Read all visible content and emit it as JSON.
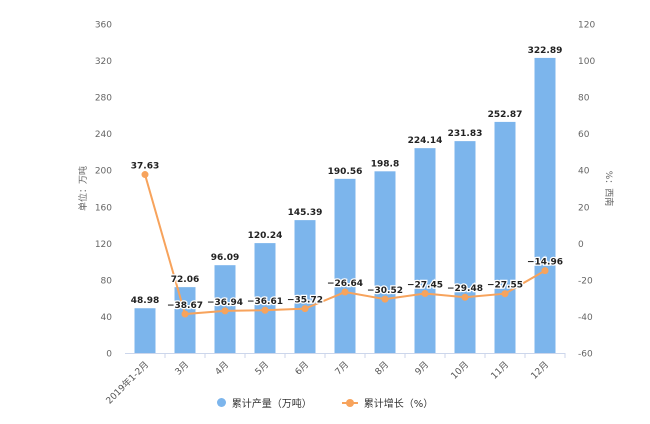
{
  "chart_data": {
    "type": "bar",
    "categories": [
      "2019年1-2月",
      "3月",
      "4月",
      "5月",
      "6月",
      "7月",
      "8月",
      "9月",
      "10月",
      "11月",
      "12月"
    ],
    "series": [
      {
        "name": "累计产量（万吨）",
        "type": "bar",
        "axis": "left",
        "color": "#7cb5ec",
        "values": [
          48.98,
          72.06,
          96.09,
          120.24,
          145.39,
          190.56,
          198.8,
          224.14,
          231.83,
          252.87,
          322.89
        ],
        "labels": [
          "48.98",
          "72.06",
          "96.09",
          "120.24",
          "145.39",
          "190.56",
          "198.8",
          "224.14",
          "231.83",
          "252.87",
          "322.89"
        ]
      },
      {
        "name": "累计增长（%）",
        "type": "line",
        "axis": "right",
        "color": "#f7a35c",
        "values": [
          37.63,
          -38.67,
          -36.94,
          -36.61,
          -35.72,
          -26.64,
          -30.52,
          -27.45,
          -29.48,
          -27.55,
          -14.96
        ],
        "labels": [
          "37.63",
          "−38.67",
          "−36.94",
          "−36.61",
          "−35.72",
          "−26.64",
          "−30.52",
          "−27.45",
          "−29.48",
          "−27.55",
          "−14.96"
        ]
      }
    ],
    "ylabel": "单位：万吨",
    "ylabel_right": "%：西南",
    "ylim": [
      0,
      360
    ],
    "yticks": [
      0,
      40,
      80,
      120,
      160,
      200,
      240,
      280,
      320,
      360
    ],
    "ylim_right": [
      -60,
      120
    ],
    "yticks_right": [
      -60,
      -40,
      -20,
      0,
      20,
      40,
      60,
      80,
      100,
      120
    ],
    "grid": false,
    "legend": "bottom-center"
  },
  "legend": {
    "bar_label": "累计产量（万吨）",
    "line_label": "累计增长（%）"
  }
}
